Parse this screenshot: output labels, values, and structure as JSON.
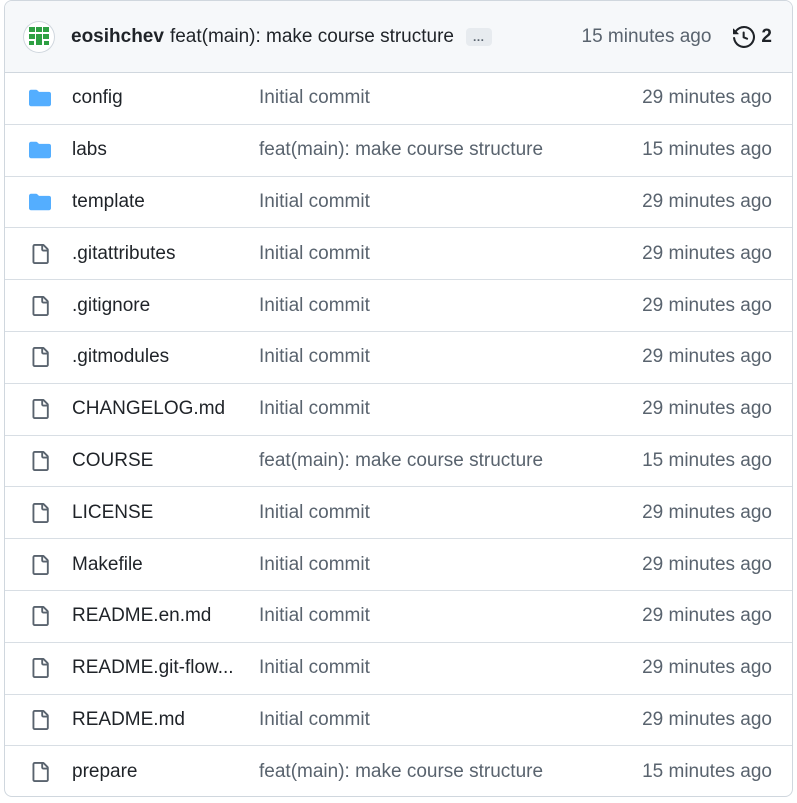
{
  "header": {
    "author": "eosihchev",
    "message": "feat(main): make course structure",
    "ellipsis": "…",
    "time": "15 minutes ago",
    "history_count": "2",
    "avatar_color": "#2ea043",
    "history_icon": "history-icon"
  },
  "colors": {
    "folder": "#54aeff",
    "muted": "#59636e",
    "border": "#d0d7de"
  },
  "files": [
    {
      "type": "folder",
      "name": "config",
      "commit": "Initial commit",
      "time": "29 minutes ago"
    },
    {
      "type": "folder",
      "name": "labs",
      "commit": "feat(main): make course structure",
      "time": "15 minutes ago"
    },
    {
      "type": "folder",
      "name": "template",
      "commit": "Initial commit",
      "time": "29 minutes ago"
    },
    {
      "type": "file",
      "name": ".gitattributes",
      "commit": "Initial commit",
      "time": "29 minutes ago"
    },
    {
      "type": "file",
      "name": ".gitignore",
      "commit": "Initial commit",
      "time": "29 minutes ago"
    },
    {
      "type": "file",
      "name": ".gitmodules",
      "commit": "Initial commit",
      "time": "29 minutes ago"
    },
    {
      "type": "file",
      "name": "CHANGELOG.md",
      "commit": "Initial commit",
      "time": "29 minutes ago"
    },
    {
      "type": "file",
      "name": "COURSE",
      "commit": "feat(main): make course structure",
      "time": "15 minutes ago"
    },
    {
      "type": "file",
      "name": "LICENSE",
      "commit": "Initial commit",
      "time": "29 minutes ago"
    },
    {
      "type": "file",
      "name": "Makefile",
      "commit": "Initial commit",
      "time": "29 minutes ago"
    },
    {
      "type": "file",
      "name": "README.en.md",
      "commit": "Initial commit",
      "time": "29 minutes ago"
    },
    {
      "type": "file",
      "name": "README.git-flow...",
      "commit": "Initial commit",
      "time": "29 minutes ago"
    },
    {
      "type": "file",
      "name": "README.md",
      "commit": "Initial commit",
      "time": "29 minutes ago"
    },
    {
      "type": "file",
      "name": "prepare",
      "commit": "feat(main): make course structure",
      "time": "15 minutes ago"
    }
  ]
}
